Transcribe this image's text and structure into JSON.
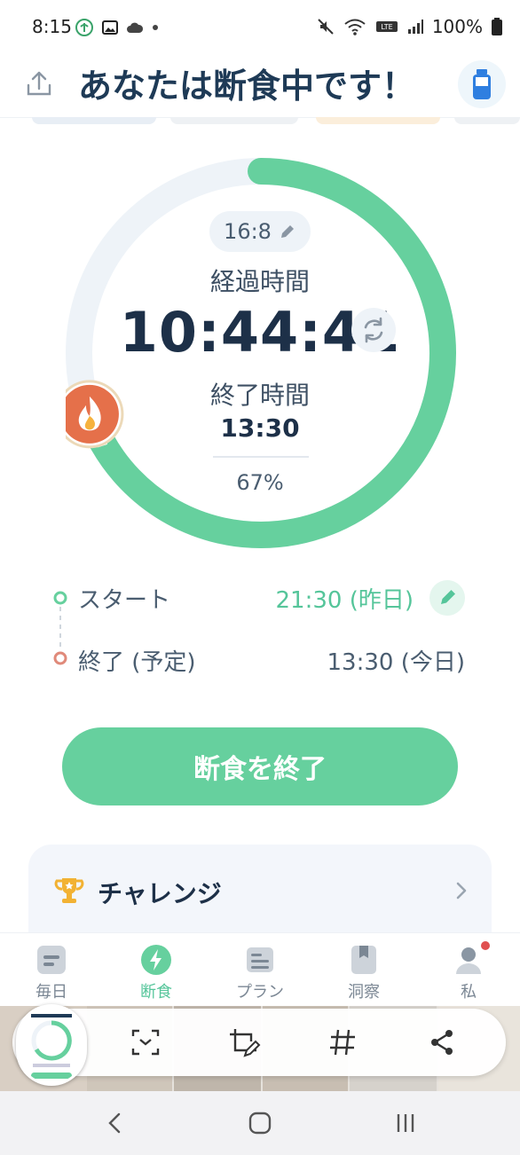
{
  "status_bar": {
    "time": "8:15",
    "battery": "100%"
  },
  "header": {
    "title": "あなたは断食中です！"
  },
  "timer": {
    "plan": "16:8",
    "elapsed_label": "経過時間",
    "elapsed": "10:44:41",
    "end_label": "終了時間",
    "end_time": "13:30",
    "progress_percent": "67%",
    "progress_fraction": 0.67
  },
  "schedule": {
    "start_label": "スタート",
    "start_value": "21:30 (昨日)",
    "end_label": "終了 (予定)",
    "end_value": "13:30 (今日)"
  },
  "actions": {
    "end_fast": "断食を終了"
  },
  "challenge": {
    "title": "チャレンジ"
  },
  "bottom_nav": [
    {
      "label": "毎日"
    },
    {
      "label": "断食"
    },
    {
      "label": "プラン"
    },
    {
      "label": "洞察"
    },
    {
      "label": "私"
    }
  ],
  "colors": {
    "accent": "#66d09e",
    "title": "#1e3a56",
    "ring_track": "#eef3f8",
    "end_dot": "#e08a7a"
  },
  "icons": [
    "share-icon",
    "water-bottle-icon",
    "pencil-icon",
    "refresh-icon",
    "flame-icon",
    "trophy-icon",
    "chevron-right-icon",
    "scan-icon",
    "crop-edit-icon",
    "hashtag-icon",
    "share-node-icon",
    "back-icon",
    "home-icon",
    "recents-icon"
  ]
}
